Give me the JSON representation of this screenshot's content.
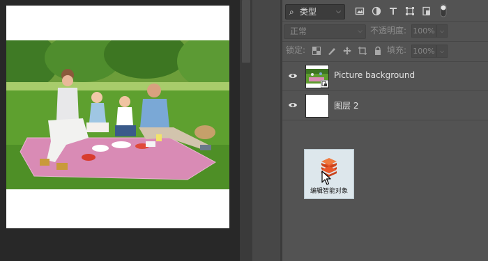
{
  "layers_panel": {
    "filter": {
      "kind_label": "类型"
    },
    "blend_mode": "正常",
    "opacity_label": "不透明度:",
    "opacity_value": "100%",
    "lock_label": "锁定:",
    "fill_label": "填充:",
    "fill_value": "100%",
    "layers": [
      {
        "name": "Picture background",
        "visible": true,
        "smart_object": true
      },
      {
        "name": "图层 2",
        "visible": true,
        "smart_object": false
      }
    ]
  },
  "drag_preview": {
    "label": "编辑智能对象"
  },
  "colors": {
    "panel_bg": "#535353",
    "canvas_bg": "#282828",
    "smart_object_orange": "#e8572a"
  }
}
